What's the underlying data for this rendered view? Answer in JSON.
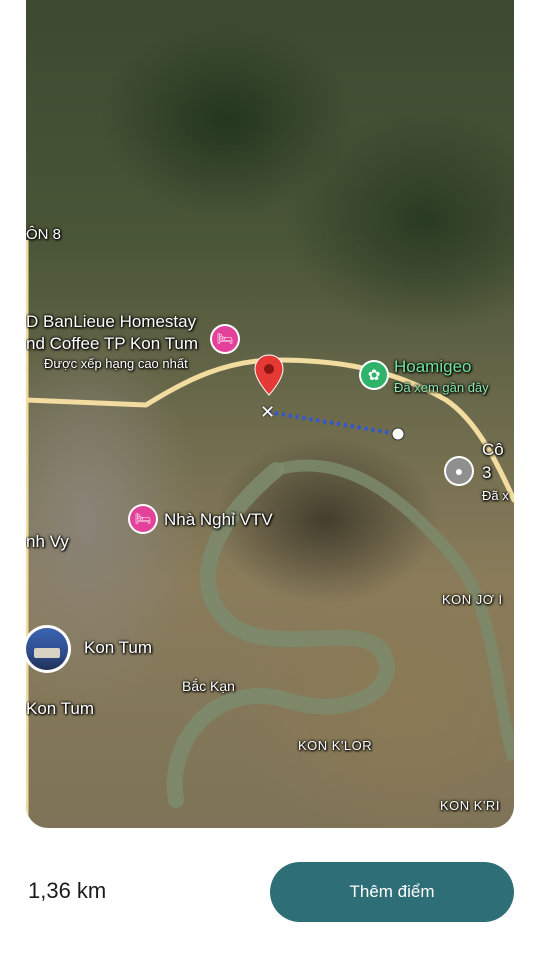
{
  "map": {
    "labels": {
      "area_on8": "ÔN 8",
      "homestay_line1": "D BanLieue Homestay",
      "homestay_line2": "nd Coffee TP Kon Tum",
      "homestay_sub": "Được xếp hạng cao nhất",
      "hoamigeo": "Hoamigeo",
      "hoamigeo_sub": "Đã xem gần đây",
      "co_line1": "Cô",
      "co_line2": "3",
      "co_sub": "Đã x",
      "nha_nghi": "Nhà Nghỉ VTV",
      "nh_vy": "nh Vy",
      "kon_jo": "KON JƠ I",
      "kon_tum_city": "Kon Tum",
      "bac_kan": "Bắc Kạn",
      "kon_tum_left": "Kon Tum",
      "kon_klor": "KON K'LOR",
      "kon_kri": "KON K'RI"
    },
    "icons": {
      "hotel": "hotel-icon",
      "attraction": "flower-icon",
      "place": "place-icon",
      "marker": "location-pin-icon",
      "vertex": "close-icon"
    }
  },
  "footer": {
    "distance": "1,36 km",
    "add_point_label": "Thêm điểm"
  },
  "colors": {
    "button": "#2e6e76",
    "measure_line": "#2f56d8",
    "pin": "#e53935",
    "hotel_poi": "#e4419a",
    "attraction_poi": "#2fb36b",
    "road": "#f2dca0"
  }
}
